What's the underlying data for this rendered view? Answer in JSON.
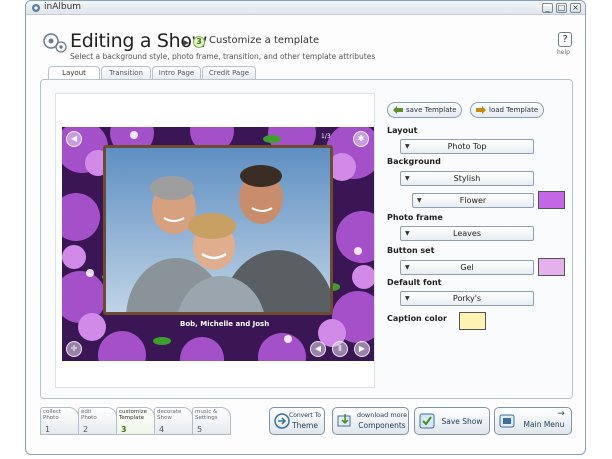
{
  "window": {
    "app_title": "inAlbum",
    "controls": {
      "minimize": "_",
      "maximize": "□",
      "close": "×"
    }
  },
  "header": {
    "title": "Editing a Show",
    "step_number": "3",
    "step_title": "Customize a template",
    "subtitle": "Select a background style, photo frame, transition, and other template attributes",
    "help_icon": "?",
    "help_label": "help"
  },
  "tabs": [
    {
      "label": "Layout",
      "active": true
    },
    {
      "label": "Transition",
      "active": false
    },
    {
      "label": "Intro Page",
      "active": false
    },
    {
      "label": "Credit Page",
      "active": false
    }
  ],
  "preview": {
    "caption": "Bob, Michelle and Josh",
    "counter": "1/3",
    "icons": [
      "volume-icon",
      "settings-icon",
      "fullscreen-icon",
      "previous-icon",
      "pause-icon",
      "next-icon"
    ]
  },
  "settings": {
    "save_template": "save Template",
    "load_template": "load Template",
    "layout_label": "Layout",
    "layout_value": "Photo Top",
    "background_label": "Background",
    "background_value": "Stylish",
    "background_sub_value": "Flower",
    "background_color": "#c566e6",
    "photo_frame_label": "Photo frame",
    "photo_frame_value": "Leaves",
    "button_set_label": "Button set",
    "button_set_value": "Gel",
    "button_set_color": "#e6b0ee",
    "default_font_label": "Default font",
    "default_font_value": "Porky's",
    "caption_color_label": "Caption color",
    "caption_color": "#fff3b4"
  },
  "wizard_steps": [
    {
      "label1": "collect",
      "label2": "Photo",
      "num": "1",
      "active": false
    },
    {
      "label1": "edit",
      "label2": "Photo",
      "num": "2",
      "active": false
    },
    {
      "label1": "customize",
      "label2": "Template",
      "num": "3",
      "active": true
    },
    {
      "label1": "decorate",
      "label2": "Show",
      "num": "4",
      "active": false
    },
    {
      "label1": "music &",
      "label2": "Settings",
      "num": "5",
      "active": false
    }
  ],
  "actions": {
    "convert_line1": "Convert To",
    "convert_line2": "Theme",
    "download_line1": "download more",
    "download_line2": "Components",
    "save_show": "Save Show",
    "main_menu": "Main Menu"
  }
}
